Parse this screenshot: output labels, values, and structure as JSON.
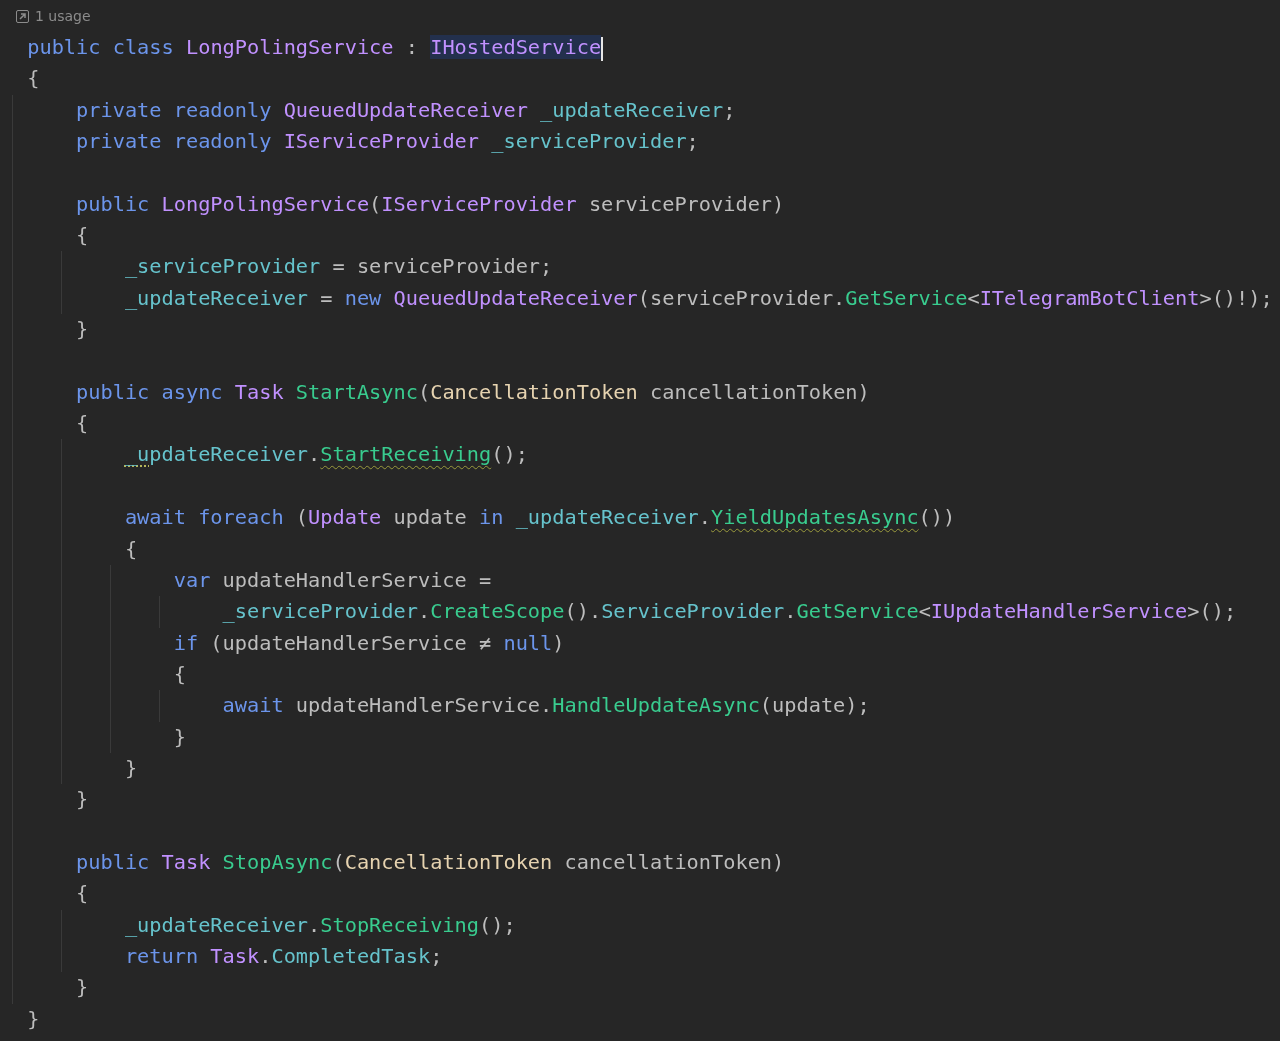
{
  "usage_hint": {
    "text": "1 usage"
  },
  "lines": [
    {
      "kind": "code",
      "tokens": [
        {
          "kind": "keyword",
          "text": "public"
        },
        {
          "kind": "keyword",
          "text": " class"
        },
        {
          "kind": "type",
          "text": " LongPolingService"
        },
        {
          "kind": "plain",
          "text": " : "
        },
        {
          "kind": "type",
          "text": "IHostedService",
          "selected": true,
          "caret": true
        }
      ]
    },
    {
      "kind": "code",
      "tokens": [
        {
          "kind": "plain",
          "text": "{"
        }
      ],
      "children": [
        {
          "kind": "code",
          "tokens": [
            {
              "kind": "keyword",
              "text": "private"
            },
            {
              "kind": "keyword",
              "text": " readonly"
            },
            {
              "kind": "type",
              "text": " QueuedUpdateReceiver"
            },
            {
              "kind": "field",
              "text": " _updateReceiver"
            },
            {
              "kind": "plain",
              "text": ";"
            }
          ]
        },
        {
          "kind": "code",
          "tokens": [
            {
              "kind": "keyword",
              "text": "private"
            },
            {
              "kind": "keyword",
              "text": " readonly"
            },
            {
              "kind": "type",
              "text": " IServiceProvider"
            },
            {
              "kind": "field",
              "text": " _serviceProvider"
            },
            {
              "kind": "plain",
              "text": ";"
            }
          ]
        },
        {
          "kind": "blank"
        },
        {
          "kind": "code",
          "tokens": [
            {
              "kind": "keyword",
              "text": "public"
            },
            {
              "kind": "type",
              "text": " LongPolingService"
            },
            {
              "kind": "plain",
              "text": "("
            },
            {
              "kind": "type",
              "text": "IServiceProvider"
            },
            {
              "kind": "plain",
              "text": " serviceProvider)"
            }
          ]
        },
        {
          "kind": "code",
          "tokens": [
            {
              "kind": "plain",
              "text": "{"
            }
          ],
          "children": [
            {
              "kind": "code",
              "tokens": [
                {
                  "kind": "field",
                  "text": "_serviceProvider"
                },
                {
                  "kind": "plain",
                  "text": " = serviceProvider;"
                }
              ]
            },
            {
              "kind": "code",
              "tokens": [
                {
                  "kind": "field",
                  "text": "_updateReceiver"
                },
                {
                  "kind": "plain",
                  "text": " = "
                },
                {
                  "kind": "keyword",
                  "text": "new"
                },
                {
                  "kind": "type",
                  "text": " QueuedUpdateReceiver"
                },
                {
                  "kind": "plain",
                  "text": "(serviceProvider."
                },
                {
                  "kind": "method",
                  "text": "GetService"
                },
                {
                  "kind": "plain",
                  "text": "<"
                },
                {
                  "kind": "type",
                  "text": "ITelegramBotClient"
                },
                {
                  "kind": "plain",
                  "text": ">()!);"
                }
              ]
            }
          ]
        },
        {
          "kind": "code",
          "tokens": [
            {
              "kind": "plain",
              "text": "}"
            }
          ]
        },
        {
          "kind": "blank"
        },
        {
          "kind": "code",
          "tokens": [
            {
              "kind": "keyword",
              "text": "public"
            },
            {
              "kind": "keyword",
              "text": " async"
            },
            {
              "kind": "type",
              "text": " Task"
            },
            {
              "kind": "method",
              "text": " StartAsync"
            },
            {
              "kind": "plain",
              "text": "("
            },
            {
              "kind": "struct",
              "text": "CancellationToken"
            },
            {
              "kind": "plain",
              "text": " cancellationToken)"
            }
          ]
        },
        {
          "kind": "code",
          "tokens": [
            {
              "kind": "plain",
              "text": "{"
            }
          ],
          "children": [
            {
              "kind": "code",
              "tokens": [
                {
                  "kind": "field",
                  "text": "_u",
                  "hint": true
                },
                {
                  "kind": "field",
                  "text": "pdateReceiver"
                },
                {
                  "kind": "plain",
                  "text": "."
                },
                {
                  "kind": "method",
                  "text": "StartReceiving",
                  "warning": true
                },
                {
                  "kind": "plain",
                  "text": "();"
                }
              ]
            },
            {
              "kind": "blank"
            },
            {
              "kind": "code",
              "tokens": [
                {
                  "kind": "keyword",
                  "text": "await"
                },
                {
                  "kind": "keyword",
                  "text": " foreach"
                },
                {
                  "kind": "plain",
                  "text": " ("
                },
                {
                  "kind": "type",
                  "text": "Update"
                },
                {
                  "kind": "plain",
                  "text": " update "
                },
                {
                  "kind": "keyword",
                  "text": "in"
                },
                {
                  "kind": "field",
                  "text": " _updateReceiver"
                },
                {
                  "kind": "plain",
                  "text": "."
                },
                {
                  "kind": "method",
                  "text": "YieldUpdatesAsync",
                  "warning": true
                },
                {
                  "kind": "plain",
                  "text": "())"
                }
              ]
            },
            {
              "kind": "code",
              "tokens": [
                {
                  "kind": "plain",
                  "text": "{"
                }
              ],
              "children": [
                {
                  "kind": "code",
                  "tokens": [
                    {
                      "kind": "keyword",
                      "text": "var"
                    },
                    {
                      "kind": "plain",
                      "text": " updateHandlerService ="
                    }
                  ],
                  "children": [
                    {
                      "kind": "code",
                      "tokens": [
                        {
                          "kind": "field",
                          "text": "_serviceProvider"
                        },
                        {
                          "kind": "plain",
                          "text": "."
                        },
                        {
                          "kind": "method",
                          "text": "CreateScope"
                        },
                        {
                          "kind": "plain",
                          "text": "()."
                        },
                        {
                          "kind": "field",
                          "text": "ServiceProvider"
                        },
                        {
                          "kind": "plain",
                          "text": "."
                        },
                        {
                          "kind": "method",
                          "text": "GetService"
                        },
                        {
                          "kind": "plain",
                          "text": "<"
                        },
                        {
                          "kind": "type",
                          "text": "IUpdateHandlerService"
                        },
                        {
                          "kind": "plain",
                          "text": ">();"
                        }
                      ]
                    }
                  ]
                },
                {
                  "kind": "code",
                  "tokens": [
                    {
                      "kind": "keyword",
                      "text": "if"
                    },
                    {
                      "kind": "plain",
                      "text": " (updateHandlerService ≠ "
                    },
                    {
                      "kind": "keyword",
                      "text": "null"
                    },
                    {
                      "kind": "plain",
                      "text": ")"
                    }
                  ]
                },
                {
                  "kind": "code",
                  "tokens": [
                    {
                      "kind": "plain",
                      "text": "{"
                    }
                  ],
                  "children": [
                    {
                      "kind": "code",
                      "tokens": [
                        {
                          "kind": "keyword",
                          "text": "await"
                        },
                        {
                          "kind": "plain",
                          "text": " updateHandlerService."
                        },
                        {
                          "kind": "method",
                          "text": "HandleUpdateAsync"
                        },
                        {
                          "kind": "plain",
                          "text": "(update);"
                        }
                      ]
                    }
                  ]
                },
                {
                  "kind": "code",
                  "tokens": [
                    {
                      "kind": "plain",
                      "text": "}"
                    }
                  ]
                }
              ]
            },
            {
              "kind": "code",
              "tokens": [
                {
                  "kind": "plain",
                  "text": "}"
                }
              ]
            }
          ]
        },
        {
          "kind": "code",
          "tokens": [
            {
              "kind": "plain",
              "text": "}"
            }
          ]
        },
        {
          "kind": "blank"
        },
        {
          "kind": "code",
          "tokens": [
            {
              "kind": "keyword",
              "text": "public"
            },
            {
              "kind": "type",
              "text": " Task"
            },
            {
              "kind": "method",
              "text": " StopAsync"
            },
            {
              "kind": "plain",
              "text": "("
            },
            {
              "kind": "struct",
              "text": "CancellationToken"
            },
            {
              "kind": "plain",
              "text": " cancellationToken)"
            }
          ]
        },
        {
          "kind": "code",
          "tokens": [
            {
              "kind": "plain",
              "text": "{"
            }
          ],
          "children": [
            {
              "kind": "code",
              "tokens": [
                {
                  "kind": "field",
                  "text": "_updateReceiver"
                },
                {
                  "kind": "plain",
                  "text": "."
                },
                {
                  "kind": "method",
                  "text": "StopReceiving"
                },
                {
                  "kind": "plain",
                  "text": "();"
                }
              ]
            },
            {
              "kind": "code",
              "tokens": [
                {
                  "kind": "keyword",
                  "text": "return"
                },
                {
                  "kind": "type",
                  "text": " Task"
                },
                {
                  "kind": "plain",
                  "text": "."
                },
                {
                  "kind": "field",
                  "text": "CompletedTask"
                },
                {
                  "kind": "plain",
                  "text": ";"
                }
              ]
            }
          ]
        },
        {
          "kind": "code",
          "tokens": [
            {
              "kind": "plain",
              "text": "}"
            }
          ]
        }
      ]
    },
    {
      "kind": "code",
      "tokens": [
        {
          "kind": "plain",
          "text": "}"
        }
      ]
    }
  ]
}
